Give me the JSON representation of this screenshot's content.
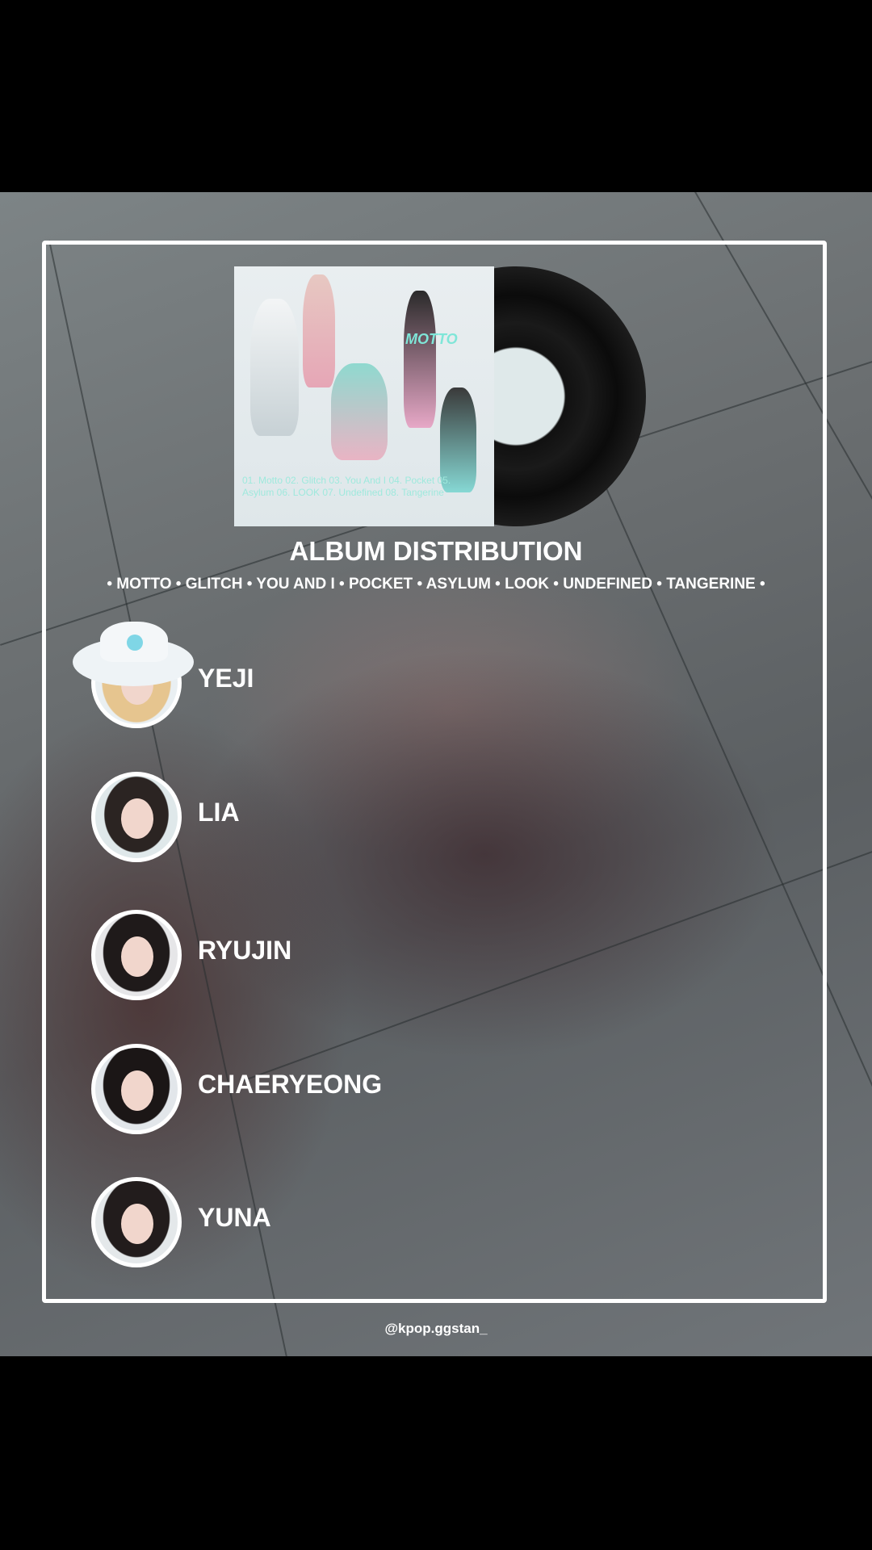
{
  "album": {
    "cover_logo": "MOTTO",
    "cover_tracks": "01. Motto 02. Glitch 03. You And I 04. Pocket 05. Asylum 06. LOOK 07. Undefined 08. Tangerine",
    "title": "ALBUM DISTRIBUTION",
    "tracklist": "• MOTTO • GLITCH • YOU AND I • POCKET • ASYLUM • LOOK • UNDEFINED • TANGERINE •"
  },
  "members": [
    {
      "name": "YEJI"
    },
    {
      "name": "LIA"
    },
    {
      "name": "RYUJIN"
    },
    {
      "name": "CHAERYEONG"
    },
    {
      "name": "YUNA"
    }
  ],
  "watermark": "@kpop.ggstan_",
  "colors": {
    "frame": "#ffffff",
    "text": "#ffffff",
    "background": "#000000",
    "accent": "#7fe6d8"
  }
}
